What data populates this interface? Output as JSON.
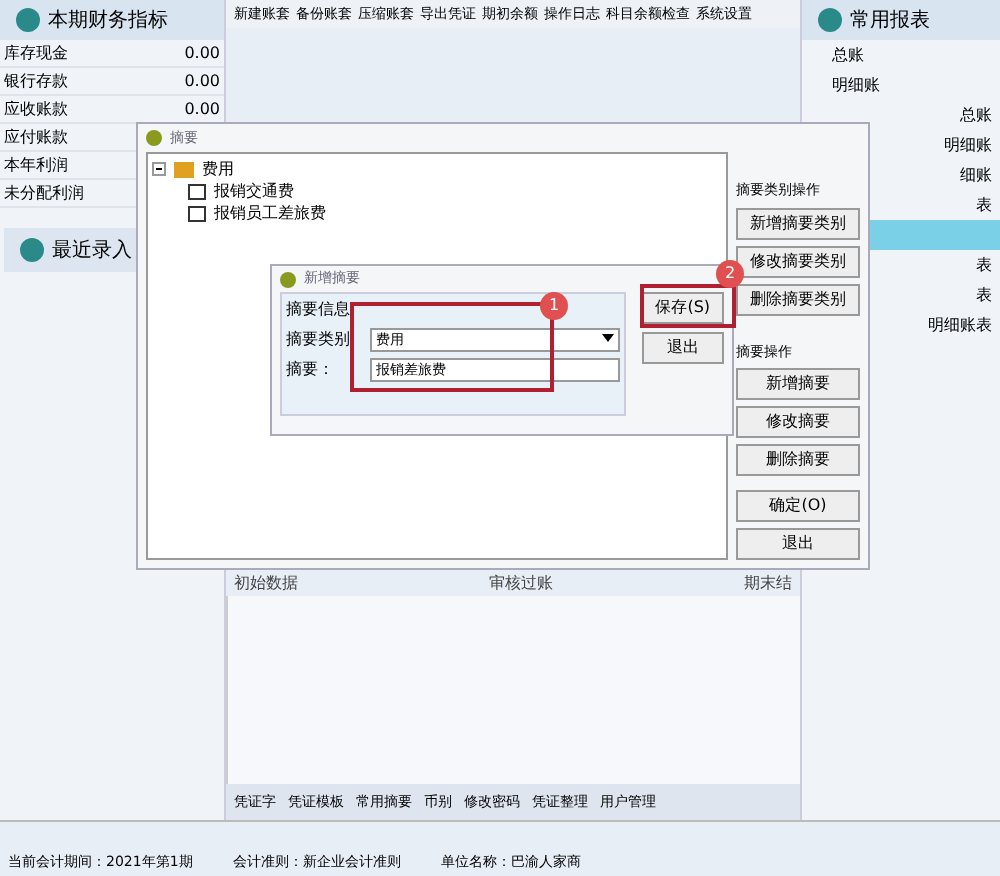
{
  "left_panel": {
    "title": "本期财务指标",
    "rows": [
      {
        "label": "库存现金",
        "value": "0.00"
      },
      {
        "label": "银行存款",
        "value": "0.00"
      },
      {
        "label": "应收账款",
        "value": "0.00"
      },
      {
        "label": "应付账款",
        "value": ""
      },
      {
        "label": "本年利润",
        "value": ""
      },
      {
        "label": "未分配利润",
        "value": ""
      }
    ],
    "recent_button": "最近录入"
  },
  "toolbar": [
    "新建账套",
    "备份账套",
    "压缩账套",
    "导出凭证",
    "期初余额",
    "操作日志",
    "科目余额检查",
    "系统设置"
  ],
  "right_panel": {
    "title": "常用报表",
    "items": [
      {
        "label": "总账",
        "selected": false
      },
      {
        "label": "明细账",
        "selected": false
      },
      {
        "label": "总账",
        "selected": false
      },
      {
        "label": "明细账",
        "selected": false
      },
      {
        "label": "细账",
        "selected": false
      },
      {
        "label": "表",
        "selected": false
      },
      {
        "selected": true
      },
      {
        "label": "表",
        "selected": false
      },
      {
        "label": "表",
        "selected": false
      },
      {
        "label": "明细账表",
        "selected": false
      }
    ]
  },
  "main": {
    "columns": [
      "初始数据",
      "审核过账",
      "期末结"
    ]
  },
  "bottom_toolbar": [
    "凭证字",
    "凭证模板",
    "常用摘要",
    "币别",
    "修改密码",
    "凭证整理",
    "用户管理"
  ],
  "status_bar": [
    "当前会计期间：2021年第1期",
    "会计准则：新企业会计准则",
    "单位名称：巴渝人家商"
  ],
  "summary_dialog": {
    "title": "摘要",
    "tree": [
      {
        "label": "费用",
        "expanded": true,
        "children": [
          {
            "label": "报销交通费"
          },
          {
            "label": "报销员工差旅费"
          }
        ]
      }
    ],
    "category_group": {
      "title": "摘要类别操作",
      "buttons": [
        "新增摘要类别",
        "修改摘要类别",
        "删除摘要类别"
      ]
    },
    "summary_group": {
      "title": "摘要操作",
      "buttons": [
        "新增摘要",
        "修改摘要",
        "删除摘要"
      ]
    },
    "buttons": [
      "确定(O)",
      "退出"
    ]
  },
  "new_dialog": {
    "title": "新增摘要",
    "group": "摘要信息",
    "category_label": "摘要类别",
    "category_value": "费用",
    "summary_label": "摘要：",
    "summary_value": "报销差旅费",
    "buttons": [
      "保存(S)",
      "退出"
    ]
  },
  "markers": [
    "1",
    "2"
  ]
}
